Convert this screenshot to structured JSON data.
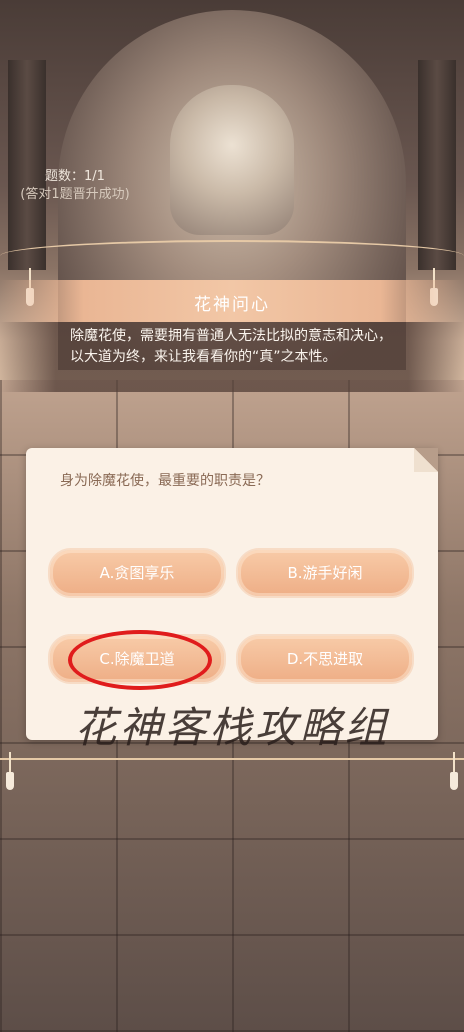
{
  "quiz": {
    "count": "题数：1/1",
    "hint": "(答对1题晋升成功)"
  },
  "panel": {
    "title": "花神问心",
    "description": "除魔花使，需要拥有普通人无法比拟的意志和决心，以大道为终，来让我看看你的“真”之本性。"
  },
  "question": {
    "text": "身为除魔花使，最重要的职责是？",
    "options": [
      "A.贪图享乐",
      "B.游手好闲",
      "C.除魔卫道",
      "D.不思进取"
    ],
    "highlighted": "C.除魔卫道"
  },
  "watermark": "花神客栈攻略组"
}
